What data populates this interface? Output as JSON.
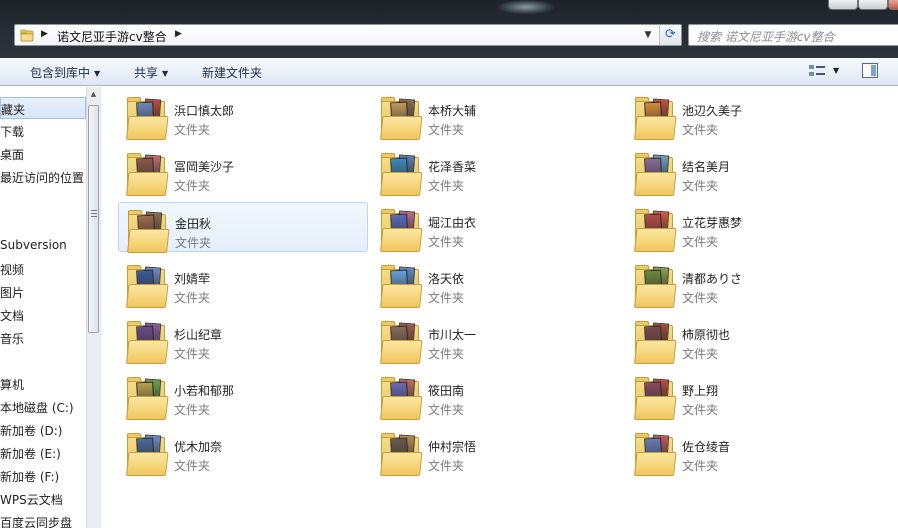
{
  "window": {
    "path": "诺文尼亚手游cv整合",
    "search_placeholder": "搜索 诺文尼亚手游cv整合"
  },
  "toolbar": {
    "include_in_library": "包含到库中",
    "share": "共享",
    "new_folder": "新建文件夹"
  },
  "nav": {
    "items": [
      "藏夹",
      "下载",
      "桌面",
      "最近访问的位置",
      "Subversion",
      "视频",
      "图片",
      "文档",
      "音乐",
      "算机",
      "本地磁盘 (C:)",
      "新加卷 (D:)",
      "新加卷 (E:)",
      "新加卷 (F:)",
      "WPS云文档",
      "百度云同步盘"
    ]
  },
  "folders": {
    "type_label": "文件夹",
    "items": [
      {
        "name": "浜口慎太郎",
        "p1": "#b84a3a",
        "p2": "#6c88b8"
      },
      {
        "name": "本桥大辅",
        "p1": "#8a6a4a",
        "p2": "#c49a5a"
      },
      {
        "name": "池辺久美子",
        "p1": "#c2503c",
        "p2": "#d88a3a"
      },
      {
        "name": "冨岡美沙子",
        "p1": "#c26a6a",
        "p2": "#8a5a4a"
      },
      {
        "name": "花泽香菜",
        "p1": "#5a7ab8",
        "p2": "#3a8ab8"
      },
      {
        "name": "结名美月",
        "p1": "#6aa0c8",
        "p2": "#8a6a9a"
      },
      {
        "name": "金田秋",
        "p1": "#8a6a4a",
        "p2": "#a06a4a"
      },
      {
        "name": "堀江由衣",
        "p1": "#b86a8a",
        "p2": "#5a6ab8"
      },
      {
        "name": "立花芽惠梦",
        "p1": "#d45a3a",
        "p2": "#b84a4a"
      },
      {
        "name": "刘婧荦",
        "p1": "#6a8ac8",
        "p2": "#3a5a9a"
      },
      {
        "name": "洛天依",
        "p1": "#5a8ac8",
        "p2": "#6aa0d8"
      },
      {
        "name": "清都ありさ",
        "p1": "#8aa04a",
        "p2": "#6a8a3a"
      },
      {
        "name": "杉山纪章",
        "p1": "#8a5aa0",
        "p2": "#6a4a8a"
      },
      {
        "name": "市川太一",
        "p1": "#a05a4a",
        "p2": "#8a6a5a"
      },
      {
        "name": "柿原彻也",
        "p1": "#a04a3a",
        "p2": "#7a4a4a"
      },
      {
        "name": "小若和郁那",
        "p1": "#6aa04a",
        "p2": "#b8a04a"
      },
      {
        "name": "筱田南",
        "p1": "#c06a5a",
        "p2": "#6a6ab8"
      },
      {
        "name": "野上翔",
        "p1": "#b84a3a",
        "p2": "#8a4a5a"
      },
      {
        "name": "优木加奈",
        "p1": "#6a8ac8",
        "p2": "#4a6a9a"
      },
      {
        "name": "仲村宗悟",
        "p1": "#b88a4a",
        "p2": "#6a5a4a"
      },
      {
        "name": "佐仓绫音",
        "p1": "#c05a5a",
        "p2": "#6a7ab8"
      }
    ]
  }
}
